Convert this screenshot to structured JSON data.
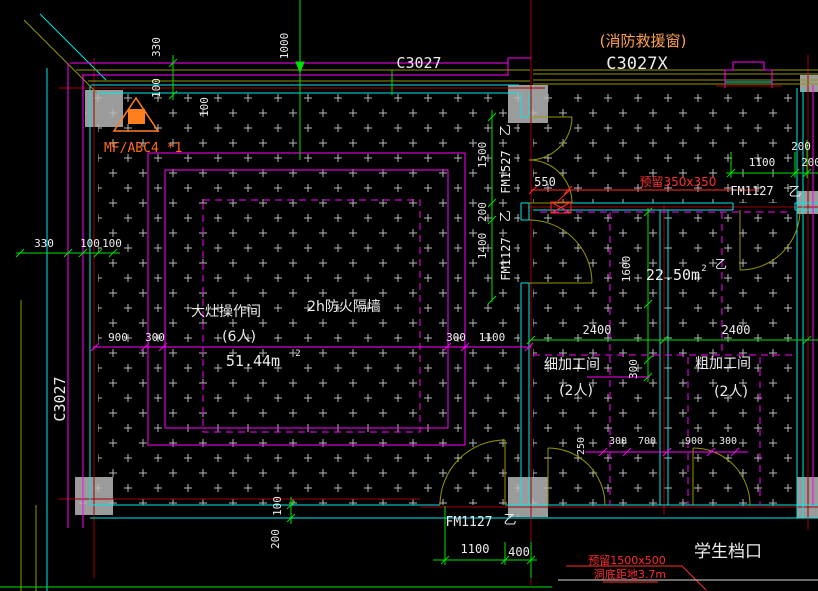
{
  "drawing": {
    "windows": {
      "top": "C3027",
      "top_right": "C3027X",
      "left": "C3027",
      "rescue_note": "(消防救援窗)"
    },
    "rooms": {
      "cooking": {
        "name": "大灶操作间",
        "capacity": "(6人)",
        "area": "51.44m",
        "area_sup": "2"
      },
      "upper_right": {
        "area": "22.50m",
        "area_sup": "2"
      },
      "fine": {
        "name": "细加工间",
        "capacity": "(2人)"
      },
      "rough": {
        "name": "粗加工间",
        "capacity": "(2人)"
      },
      "stall": "学生档口"
    },
    "partition_note": "2h防火隔墙",
    "extinguisher": "MF/ABC4 *1",
    "doors": {
      "fm1527": "FM1527",
      "fm1127": "FM1127",
      "type_yi": "乙"
    },
    "notes": {
      "reserve_350": "预留350x350",
      "reserve_550": "550",
      "reserve_1500": "预留1500x500",
      "sill_height": "洞底距地3.7m"
    },
    "dims": {
      "d100": "100",
      "d200": "200",
      "d250": "250",
      "d300": "300",
      "d330": "330",
      "d400": "400",
      "d700": "700",
      "d900": "900",
      "d1000": "1000",
      "d1100": "1100",
      "d1400": "1400",
      "d1500": "1500",
      "d1600": "1600",
      "d2400": "2400"
    }
  }
}
